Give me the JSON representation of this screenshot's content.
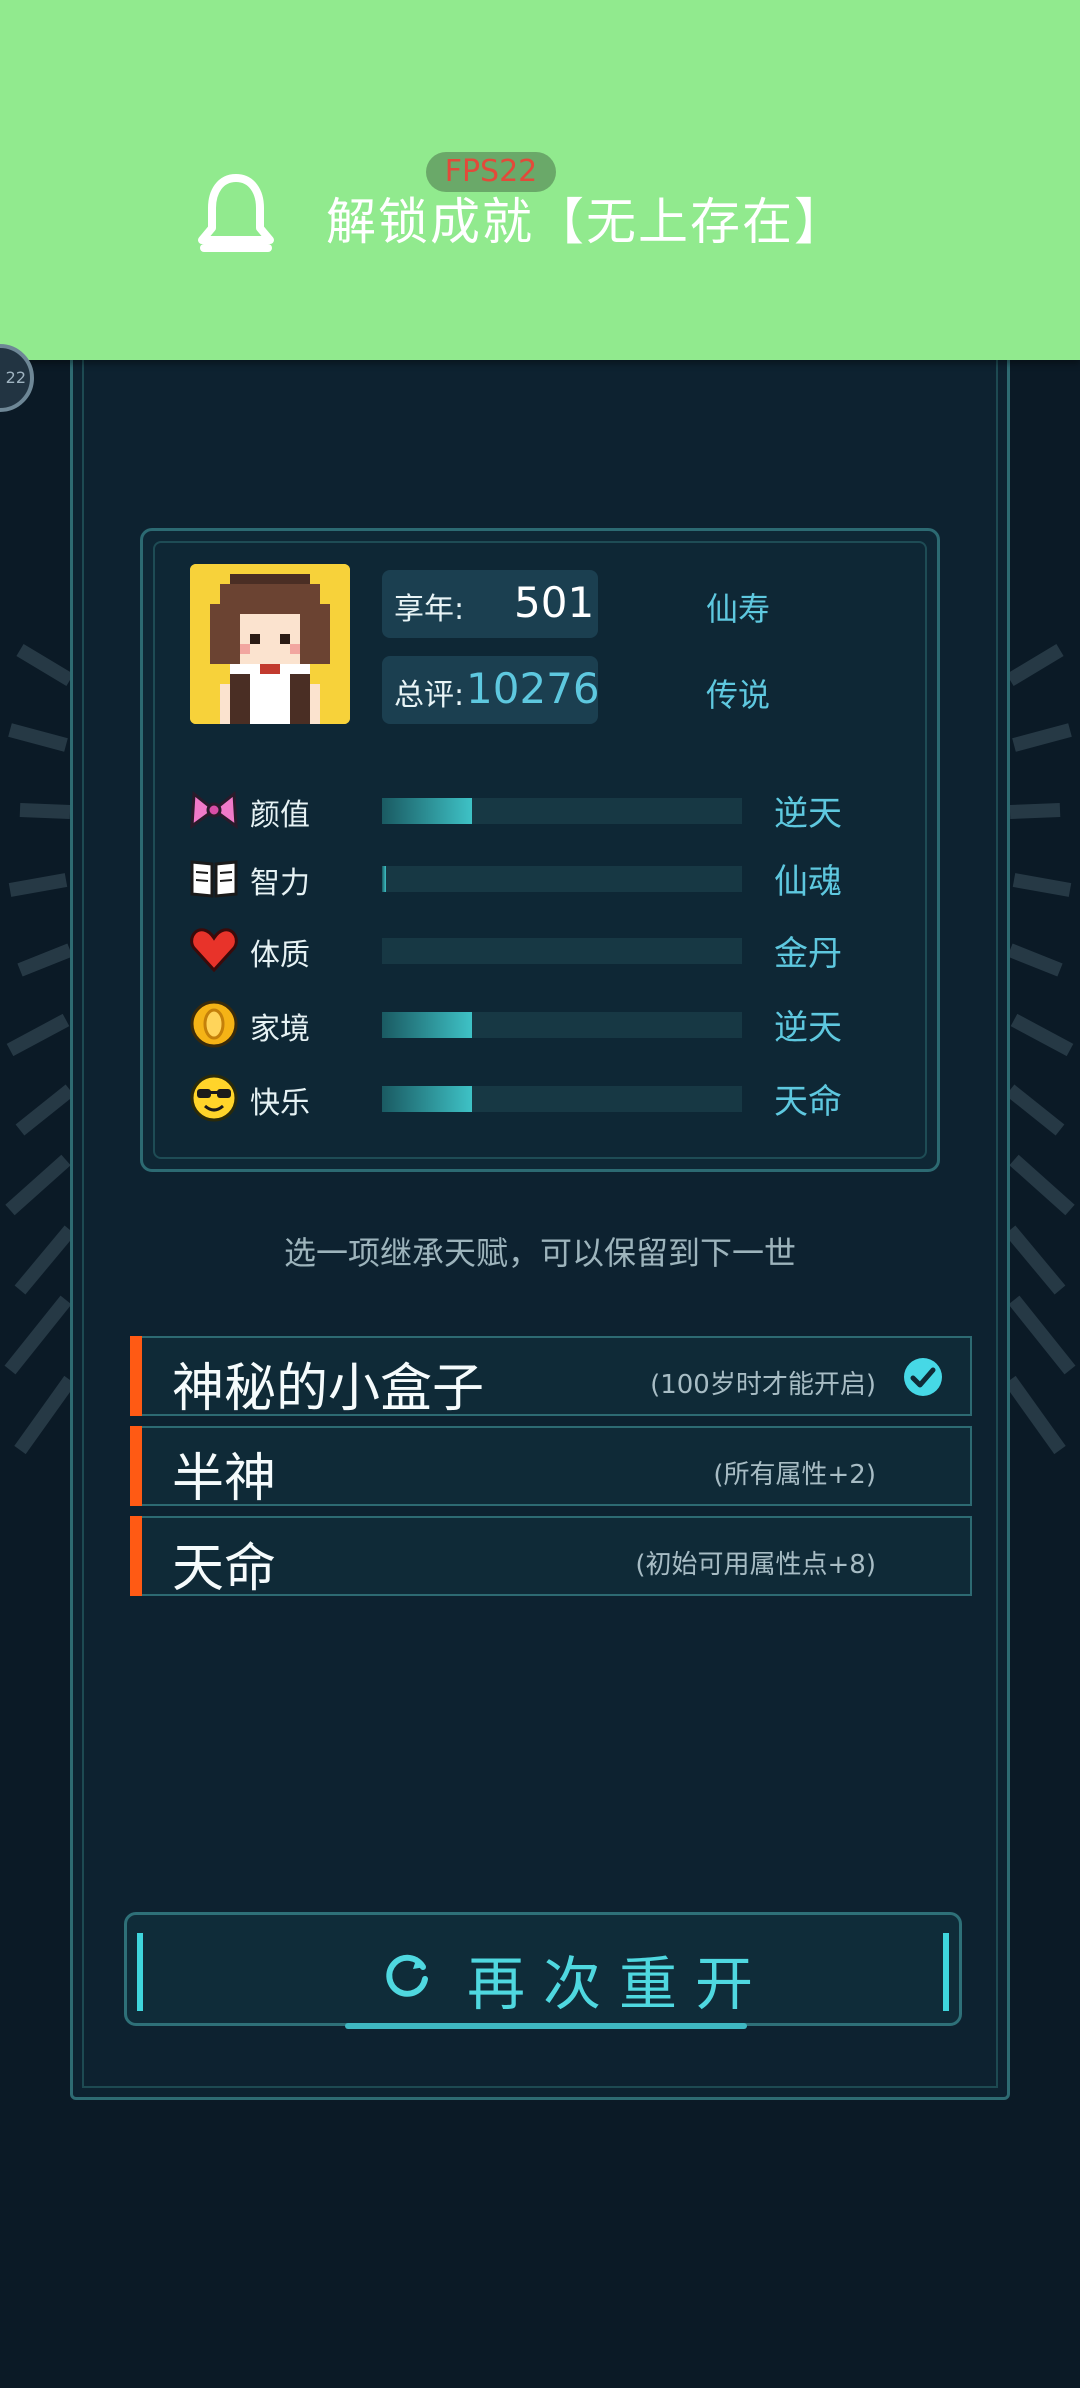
{
  "notification": {
    "icon": "bell-icon",
    "text": "解锁成就【无上存在】",
    "fps": "FPS22",
    "side_badge": "22"
  },
  "summary": {
    "age_label": "享年:",
    "age_value": "501",
    "age_rank": "仙寿",
    "score_label": "总评:",
    "score_value": "10276",
    "score_rank": "传说"
  },
  "attributes": [
    {
      "icon": "bow-icon",
      "name": "颜值",
      "level": 0.25,
      "rank": "逆天"
    },
    {
      "icon": "book-icon",
      "name": "智力",
      "level": 0.01,
      "rank": "仙魂"
    },
    {
      "icon": "heart-icon",
      "name": "体质",
      "level": 0.0,
      "rank": "金丹"
    },
    {
      "icon": "coin-icon",
      "name": "家境",
      "level": 0.25,
      "rank": "逆天"
    },
    {
      "icon": "sunglasses-face-icon",
      "name": "快乐",
      "level": 0.25,
      "rank": "天命"
    }
  ],
  "hint": "选一项继承天赋，可以保留到下一世",
  "talents": [
    {
      "name": "神秘的小盒子",
      "desc": "(100岁时才能开启)",
      "selected": true
    },
    {
      "name": "半神",
      "desc": "(所有属性+2)",
      "selected": false
    },
    {
      "name": "天命",
      "desc": "(初始可用属性点+8)",
      "selected": false
    }
  ],
  "restart_label": "再次重开",
  "colors": {
    "accent": "#5ec8df",
    "talent_bar": "#ff5a14",
    "notification_bg": "#91ea8e",
    "background": "#0b1a26"
  }
}
